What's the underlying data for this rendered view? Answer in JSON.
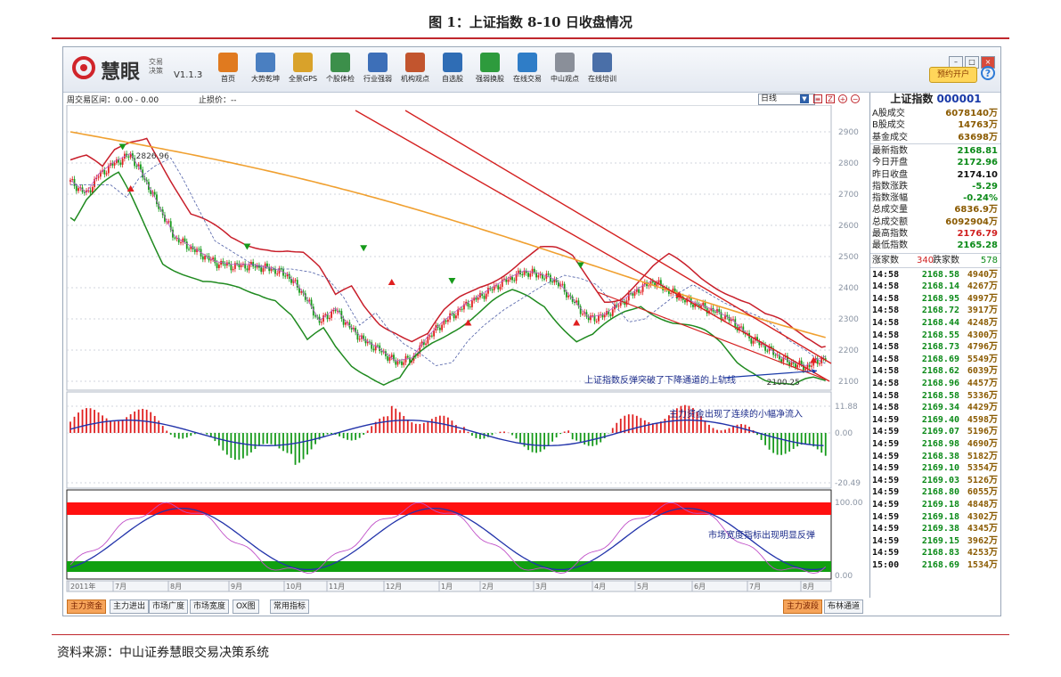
{
  "figure": {
    "title": "图 1：上证指数 8-10 日收盘情况",
    "source": "资料来源：中山证券慧眼交易决策系统"
  },
  "app": {
    "logo_text": "慧眼",
    "logo_sub_top": "交易",
    "logo_sub_bottom": "决策",
    "version": "V1.1.3",
    "toolbar": [
      {
        "label": "首页",
        "icon": "home-icon",
        "color": "#e07a1f"
      },
      {
        "label": "大势乾坤",
        "icon": "magnifier-chart-icon",
        "color": "#4a7fc1"
      },
      {
        "label": "全景GPS",
        "icon": "grid-icon",
        "color": "#d9a22a"
      },
      {
        "label": "个股体检",
        "icon": "monitor-icon",
        "color": "#3c8f4a"
      },
      {
        "label": "行业强弱",
        "icon": "bar-chart-icon",
        "color": "#3d6fb8"
      },
      {
        "label": "机构观点",
        "icon": "people-icon",
        "color": "#c2552e"
      },
      {
        "label": "自选股",
        "icon": "briefcase-icon",
        "color": "#2f6db5"
      },
      {
        "label": "强弱换股",
        "icon": "swap-icon",
        "color": "#2e9b3d"
      },
      {
        "label": "在线交易",
        "icon": "cart-icon",
        "color": "#2f7dc7"
      },
      {
        "label": "中山观点",
        "icon": "document-icon",
        "color": "#8a8f99"
      },
      {
        "label": "在线培训",
        "icon": "search-person-icon",
        "color": "#4a6fa8"
      }
    ],
    "open_account": "预约开户",
    "help_glyph": "?",
    "window_buttons": [
      "–",
      "□",
      "×"
    ]
  },
  "status": {
    "range_label": "周交易区间：0.00 - 0.00",
    "stop_label": "止损价：--",
    "period": "日线"
  },
  "chart": {
    "price_ticks": [
      "2900",
      "2800",
      "2700",
      "2600",
      "2500",
      "2400",
      "2300",
      "2200",
      "2100"
    ],
    "macd_ticks": [
      "11.88",
      "0.00",
      "-20.49"
    ],
    "breadth_ticks": [
      "100.00",
      "0.00"
    ],
    "month_labels": [
      "2011年",
      "7月",
      "8月",
      "9月",
      "10月",
      "11月",
      "12月",
      "1月",
      "2月",
      "3月",
      "4月",
      "5月",
      "6月",
      "7月",
      "8月"
    ],
    "high_label": "2826.96",
    "low_label": "2100.25",
    "annotation_price": "上证指数反弹突破了下降通道的上轨线",
    "annotation_flow": "主力资金出现了连续的小幅净流入",
    "annotation_breadth": "市场宽度指标出现明显反弹",
    "colors": {
      "up": "#e02020",
      "down": "#169a1a",
      "boll": "#c81e2a",
      "ma": "#f0a030",
      "channel": "#d42020",
      "envelope": "#1f8a1f"
    }
  },
  "bottom_tabs": {
    "left": [
      "主力资金",
      "主力进出",
      "市场广度",
      "市场宽度",
      "OX图",
      "常用指标"
    ],
    "right": [
      "主力波段",
      "布林通道"
    ],
    "active_left": "主力资金",
    "active_right": "主力波段"
  },
  "quote": {
    "name": "上证指数",
    "code": "000001",
    "stats": [
      {
        "k": "A股成交",
        "v": "6078140万",
        "c": "#8a5a00"
      },
      {
        "k": "B股成交",
        "v": "14763万",
        "c": "#8a5a00"
      },
      {
        "k": "基金成交",
        "v": "63698万",
        "c": "#8a5a00"
      },
      {
        "k": "最新指数",
        "v": "2168.81",
        "c": "#0b8a18"
      },
      {
        "k": "今日开盘",
        "v": "2172.96",
        "c": "#0b8a18"
      },
      {
        "k": "昨日收盘",
        "v": "2174.10",
        "c": "#111111"
      },
      {
        "k": "指数涨跌",
        "v": "-5.29",
        "c": "#0b8a18"
      },
      {
        "k": "指数涨幅",
        "v": "-0.24%",
        "c": "#0b8a18"
      },
      {
        "k": "总成交量",
        "v": "6836.9万",
        "c": "#8a5a00"
      },
      {
        "k": "总成交额",
        "v": "6092904万",
        "c": "#8a5a00"
      },
      {
        "k": "最高指数",
        "v": "2176.79",
        "c": "#d01f1f"
      },
      {
        "k": "最低指数",
        "v": "2165.28",
        "c": "#0b8a18"
      }
    ],
    "breadth": {
      "up_label": "涨家数",
      "up": "340",
      "down_label": "跌家数",
      "down": "578"
    },
    "ticks": [
      [
        "14:58",
        "2168.58",
        "4940万"
      ],
      [
        "14:58",
        "2168.14",
        "4267万"
      ],
      [
        "14:58",
        "2168.95",
        "4997万"
      ],
      [
        "14:58",
        "2168.72",
        "3917万"
      ],
      [
        "14:58",
        "2168.44",
        "4248万"
      ],
      [
        "14:58",
        "2168.55",
        "4300万"
      ],
      [
        "14:58",
        "2168.73",
        "4796万"
      ],
      [
        "14:58",
        "2168.69",
        "5549万"
      ],
      [
        "14:58",
        "2168.62",
        "6039万"
      ],
      [
        "14:58",
        "2168.96",
        "4457万"
      ],
      [
        "14:58",
        "2168.58",
        "5336万"
      ],
      [
        "14:58",
        "2169.34",
        "4429万"
      ],
      [
        "14:59",
        "2169.40",
        "4598万"
      ],
      [
        "14:59",
        "2169.07",
        "5196万"
      ],
      [
        "14:59",
        "2168.98",
        "4690万"
      ],
      [
        "14:59",
        "2168.38",
        "5182万"
      ],
      [
        "14:59",
        "2169.10",
        "5354万"
      ],
      [
        "14:59",
        "2169.03",
        "5126万"
      ],
      [
        "14:59",
        "2168.80",
        "6055万"
      ],
      [
        "14:59",
        "2169.18",
        "4848万"
      ],
      [
        "14:59",
        "2169.18",
        "4302万"
      ],
      [
        "14:59",
        "2169.38",
        "4345万"
      ],
      [
        "14:59",
        "2169.15",
        "3962万"
      ],
      [
        "14:59",
        "2168.83",
        "4253万"
      ],
      [
        "15:00",
        "2168.69",
        "1534万"
      ]
    ]
  }
}
